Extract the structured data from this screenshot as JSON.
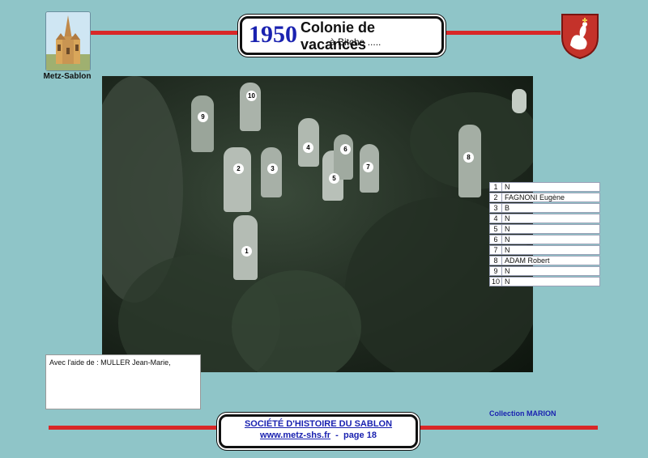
{
  "header": {
    "year": "1950",
    "title": "Colonie de vacances",
    "subtitle": "à Bitche .....",
    "logo_caption": "Metz-Sablon",
    "left_logo_icon": "church-icon",
    "right_logo_icon": "coat-of-arms-icon"
  },
  "photo": {
    "icon": "group-photo",
    "markers": [
      "1",
      "2",
      "3",
      "4",
      "5",
      "6",
      "7",
      "8",
      "9",
      "10"
    ]
  },
  "names": [
    {
      "num": "1",
      "name": "N"
    },
    {
      "num": "2",
      "name": "FAGNONI Eugène"
    },
    {
      "num": "3",
      "name": "B"
    },
    {
      "num": "4",
      "name": "N"
    },
    {
      "num": "5",
      "name": "N"
    },
    {
      "num": "6",
      "name": "N"
    },
    {
      "num": "7",
      "name": "N"
    },
    {
      "num": "8",
      "name": "ADAM Robert"
    },
    {
      "num": "9",
      "name": "N"
    },
    {
      "num": "10",
      "name": "N"
    }
  ],
  "help": {
    "text": "Avec l'aide de : MULLER Jean-Marie,"
  },
  "collection": "Collection MARION",
  "footer": {
    "society": "SOCIÉTÉ D'HISTOIRE DU SABLON",
    "url": "www.metz-shs.fr",
    "separator": "-",
    "page": "page 18"
  },
  "colors": {
    "background": "#8fc5c8",
    "accent_red": "#d92727",
    "text_blue": "#1a22b0"
  }
}
